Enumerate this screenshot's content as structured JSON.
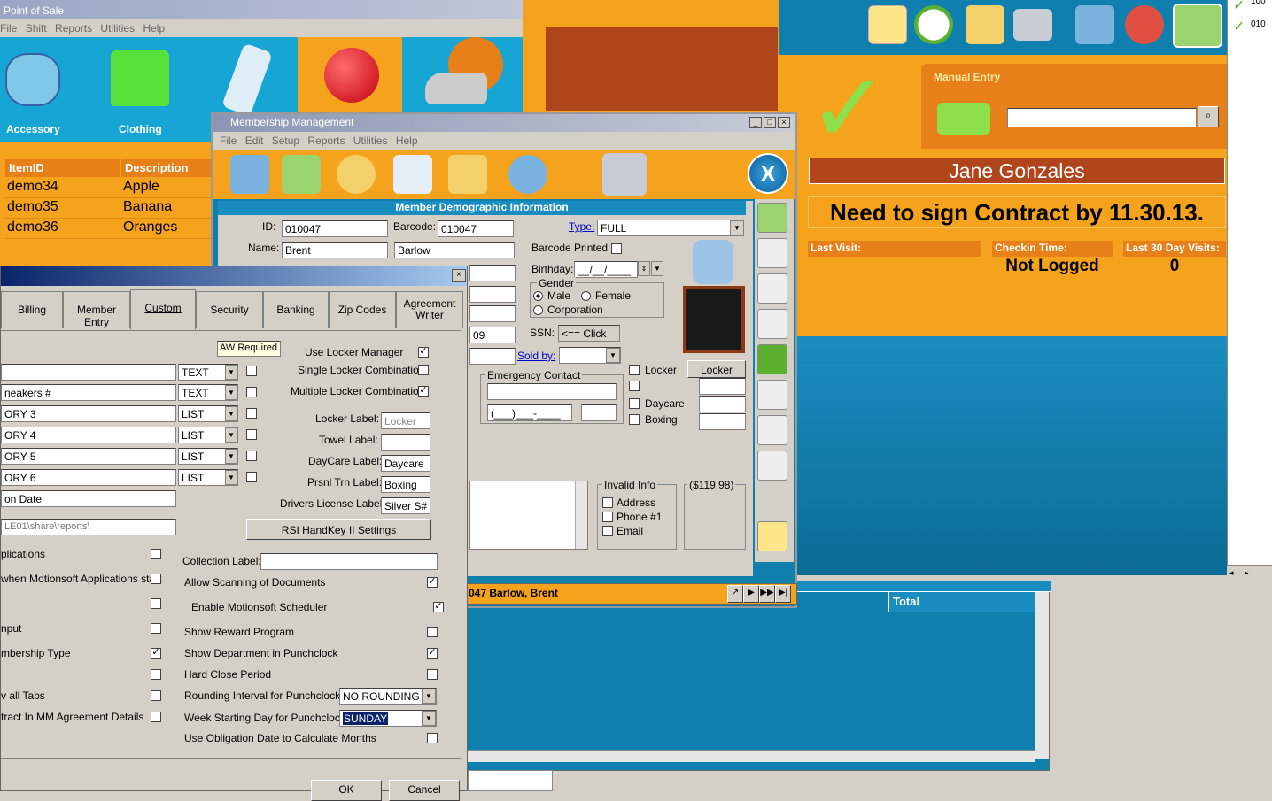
{
  "pos": {
    "title": "Point of Sale",
    "menu": [
      "File",
      "Shift",
      "Reports",
      "Utilities",
      "Help"
    ],
    "categories": [
      {
        "label": "Accessory"
      },
      {
        "label": "Clothing"
      },
      {
        "label": ""
      },
      {
        "label": ""
      },
      {
        "label": ""
      }
    ],
    "grid_headers": [
      "ItemID",
      "Description"
    ],
    "grid_rows": [
      [
        "demo34",
        "Apple"
      ],
      [
        "demo35",
        "Banana"
      ],
      [
        "demo36",
        "Oranges"
      ]
    ]
  },
  "checkin": {
    "manual_entry": "Manual Entry",
    "member_name": "Jane Gonzales",
    "message": "Need to sign Contract by 11.30.13.",
    "last_visit_label": "Last Visit:",
    "last_visit": "",
    "checkin_time_label": "Checkin Time:",
    "checkin_time": "Not Logged",
    "last30_label": "Last 30 Day Visits:",
    "last30": "0",
    "right_list": [
      "100",
      "010"
    ]
  },
  "membership": {
    "title": "Membership Management",
    "menu": [
      "File",
      "Edit",
      "Setup",
      "Reports",
      "Utilities",
      "Help"
    ],
    "close_label": "X",
    "section_title": "Member Demographic Information",
    "id_label": "ID:",
    "id": "010047",
    "barcode_label": "Barcode:",
    "barcode": "010047",
    "type_label": "Type:",
    "type": "FULL",
    "name_label": "Name:",
    "first_name": "Brent",
    "last_name": "Barlow",
    "barcode_printed": "Barcode Printed",
    "birthday_label": "Birthday:",
    "birthday": "__/__/____",
    "gender_label": "Gender",
    "male": "Male",
    "female": "Female",
    "corporation": "Corporation",
    "ssn_label": "SSN:",
    "ssn": "<== Click",
    "zip_partial": "09",
    "sold_by": "Sold by:",
    "locker": "Locker",
    "locker_btn": "Locker",
    "daycare": "Daycare",
    "boxing": "Boxing",
    "emergency": "Emergency Contact",
    "phone": "(___)___-____",
    "invalid_info": "Invalid Info",
    "address": "Address",
    "phone1": "Phone #1",
    "email": "Email",
    "balance": "($119.98)",
    "status_member": "047 Barlow, Brent",
    "total_header": "Total"
  },
  "setup": {
    "tabs": [
      "Billing",
      "Member Entry",
      "Custom",
      "Security",
      "Banking",
      "Zip Codes",
      "Agreement Writer"
    ],
    "aw_required": "AW Required",
    "custom_fields": [
      {
        "name": "",
        "type": "TEXT"
      },
      {
        "name": "neakers #",
        "type": "TEXT"
      },
      {
        "name": "ORY 3",
        "type": "LIST"
      },
      {
        "name": "ORY 4",
        "type": "LIST"
      },
      {
        "name": "ORY 5",
        "type": "LIST"
      },
      {
        "name": "ORY 6",
        "type": "LIST"
      }
    ],
    "date_field": "on Date",
    "path_field": "LE01\\share\\reports\\",
    "use_locker_manager": "Use Locker Manager",
    "single_locker": "Single Locker Combination",
    "multiple_locker": "Multiple Locker Combination",
    "locker_label": "Locker Label:",
    "locker_value": "Locker",
    "towel_label": "Towel Label:",
    "towel_value": "",
    "daycare_label": "DayCare Label:",
    "daycare_value": "Daycare",
    "prsnl_label": "Prsnl Trn Label:",
    "prsnl_value": "Boxing",
    "dl_label": "Drivers License Label:",
    "dl_value": "Silver S#",
    "rsi_button": "RSI HandKey II Settings",
    "collection_label": "Collection Label:",
    "collection_value": "",
    "left_options": [
      "plications",
      "when Motionsoft Applications start",
      "",
      "nput",
      "mbership Type",
      "",
      "v all Tabs",
      "tract In MM Agreement Details"
    ],
    "right_options": [
      "Allow Scanning of Documents",
      "Enable Motionsoft Scheduler",
      "Show Reward Program",
      "Show Department in Punchclock",
      "Hard Close Period"
    ],
    "rounding_label": "Rounding Interval for Punchclock",
    "rounding_value": "NO ROUNDING",
    "week_label": "Week Starting Day for Punchclock",
    "week_value": "SUNDAY",
    "obligation_label": "Use Obligation Date to Calculate Months",
    "ok": "OK",
    "cancel": "Cancel"
  }
}
